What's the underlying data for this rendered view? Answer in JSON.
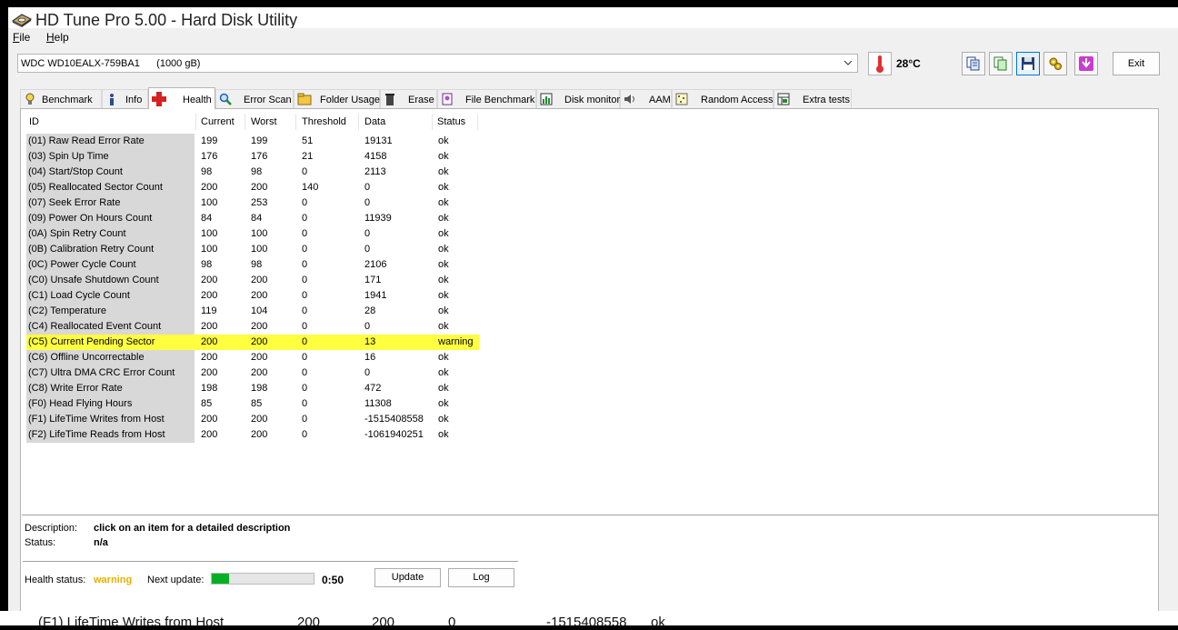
{
  "window": {
    "title": "HD Tune Pro 5.00 - Hard Disk Utility"
  },
  "menu": [
    {
      "label_prefix": "F",
      "label_rest": "ile"
    },
    {
      "label_prefix": "H",
      "label_rest": "elp"
    }
  ],
  "toolbar": {
    "drive": "WDC WD10EALX-759BA1      (1000 gB)",
    "temperature": "28°C",
    "exit_label": "Exit"
  },
  "tabs": [
    {
      "label": "Benchmark",
      "icon": "bulb-icon"
    },
    {
      "label": "Info",
      "icon": "info-icon"
    },
    {
      "label": "Health",
      "icon": "health-cross-icon",
      "active": true
    },
    {
      "label": "Error Scan",
      "icon": "magnifier-icon"
    },
    {
      "label": "Folder Usage",
      "icon": "folder-icon"
    },
    {
      "label": "Erase",
      "icon": "trash-icon"
    },
    {
      "label": "File Benchmark",
      "icon": "file-benchmark-icon"
    },
    {
      "label": "Disk monitor",
      "icon": "disk-monitor-icon"
    },
    {
      "label": "AAM",
      "icon": "speaker-icon"
    },
    {
      "label": "Random Access",
      "icon": "random-access-icon"
    },
    {
      "label": "Extra tests",
      "icon": "extra-tests-icon"
    }
  ],
  "table": {
    "columns": [
      "ID",
      "Current",
      "Worst",
      "Threshold",
      "Data",
      "Status"
    ],
    "rows": [
      {
        "id": "(01) Raw Read Error Rate",
        "current": "199",
        "worst": "199",
        "threshold": "51",
        "data": "19131",
        "status": "ok"
      },
      {
        "id": "(03) Spin Up Time",
        "current": "176",
        "worst": "176",
        "threshold": "21",
        "data": "4158",
        "status": "ok"
      },
      {
        "id": "(04) Start/Stop Count",
        "current": "98",
        "worst": "98",
        "threshold": "0",
        "data": "2113",
        "status": "ok"
      },
      {
        "id": "(05) Reallocated Sector Count",
        "current": "200",
        "worst": "200",
        "threshold": "140",
        "data": "0",
        "status": "ok"
      },
      {
        "id": "(07) Seek Error Rate",
        "current": "100",
        "worst": "253",
        "threshold": "0",
        "data": "0",
        "status": "ok"
      },
      {
        "id": "(09) Power On Hours Count",
        "current": "84",
        "worst": "84",
        "threshold": "0",
        "data": "11939",
        "status": "ok"
      },
      {
        "id": "(0A) Spin Retry Count",
        "current": "100",
        "worst": "100",
        "threshold": "0",
        "data": "0",
        "status": "ok"
      },
      {
        "id": "(0B) Calibration Retry Count",
        "current": "100",
        "worst": "100",
        "threshold": "0",
        "data": "0",
        "status": "ok"
      },
      {
        "id": "(0C) Power Cycle Count",
        "current": "98",
        "worst": "98",
        "threshold": "0",
        "data": "2106",
        "status": "ok"
      },
      {
        "id": "(C0) Unsafe Shutdown Count",
        "current": "200",
        "worst": "200",
        "threshold": "0",
        "data": "171",
        "status": "ok"
      },
      {
        "id": "(C1) Load Cycle Count",
        "current": "200",
        "worst": "200",
        "threshold": "0",
        "data": "1941",
        "status": "ok"
      },
      {
        "id": "(C2) Temperature",
        "current": "119",
        "worst": "104",
        "threshold": "0",
        "data": "28",
        "status": "ok"
      },
      {
        "id": "(C4) Reallocated Event Count",
        "current": "200",
        "worst": "200",
        "threshold": "0",
        "data": "0",
        "status": "ok"
      },
      {
        "id": "(C5) Current Pending Sector",
        "current": "200",
        "worst": "200",
        "threshold": "0",
        "data": "13",
        "status": "warning",
        "highlight": true
      },
      {
        "id": "(C6) Offline Uncorrectable",
        "current": "200",
        "worst": "200",
        "threshold": "0",
        "data": "16",
        "status": "ok"
      },
      {
        "id": "(C7) Ultra DMA CRC Error Count",
        "current": "200",
        "worst": "200",
        "threshold": "0",
        "data": "0",
        "status": "ok"
      },
      {
        "id": "(C8) Write Error Rate",
        "current": "198",
        "worst": "198",
        "threshold": "0",
        "data": "472",
        "status": "ok"
      },
      {
        "id": "(F0) Head Flying Hours",
        "current": "85",
        "worst": "85",
        "threshold": "0",
        "data": "11308",
        "status": "ok"
      },
      {
        "id": "(F1) LifeTime Writes from Host",
        "current": "200",
        "worst": "200",
        "threshold": "0",
        "data": "-1515408558",
        "status": "ok"
      },
      {
        "id": "(F2) LifeTime Reads from Host",
        "current": "200",
        "worst": "200",
        "threshold": "0",
        "data": "-1061940251",
        "status": "ok"
      }
    ]
  },
  "details": {
    "description_label": "Description:",
    "description_value": "click on an item for a detailed description",
    "status_label": "Status:",
    "status_value": "n/a",
    "health_label": "Health status:",
    "health_value": "warning",
    "next_update_label": "Next update:",
    "progress_fraction": 0.17,
    "countdown": "0:50",
    "update_label": "Update",
    "log_label": "Log"
  },
  "background_row": {
    "id": "(F1) LifeTime Writes from Host",
    "current": "200",
    "worst": "200",
    "threshold": "0",
    "data": "-1515408558",
    "status": "ok"
  },
  "colors": {
    "highlight": "#ffff40",
    "warning_text": "#e6b000",
    "progress_fill": "#06b025"
  }
}
